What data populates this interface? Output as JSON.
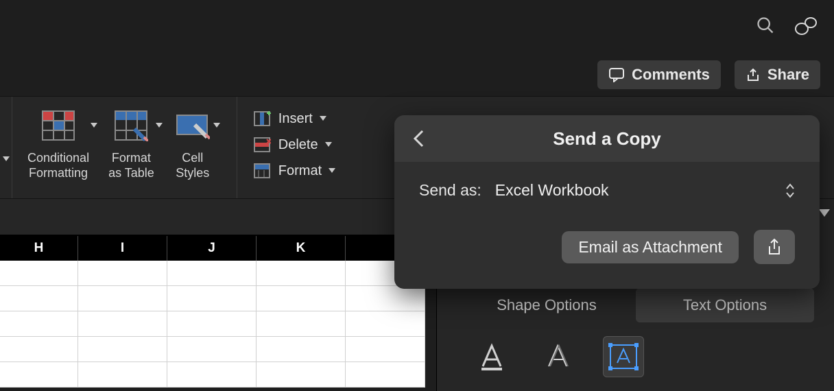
{
  "titlebar": {
    "comments_label": "Comments",
    "share_label": "Share"
  },
  "ribbon": {
    "conditional_formatting": "Conditional\nFormatting",
    "format_as_table": "Format\nas Table",
    "cell_styles": "Cell\nStyles",
    "insert": "Insert",
    "delete": "Delete",
    "format": "Format"
  },
  "columns": [
    "H",
    "I",
    "J",
    "K"
  ],
  "side_pane": {
    "shape_options": "Shape Options",
    "text_options": "Text Options"
  },
  "popover": {
    "title": "Send a Copy",
    "send_as_label": "Send as:",
    "send_as_value": "Excel Workbook",
    "email_button": "Email as Attachment"
  }
}
